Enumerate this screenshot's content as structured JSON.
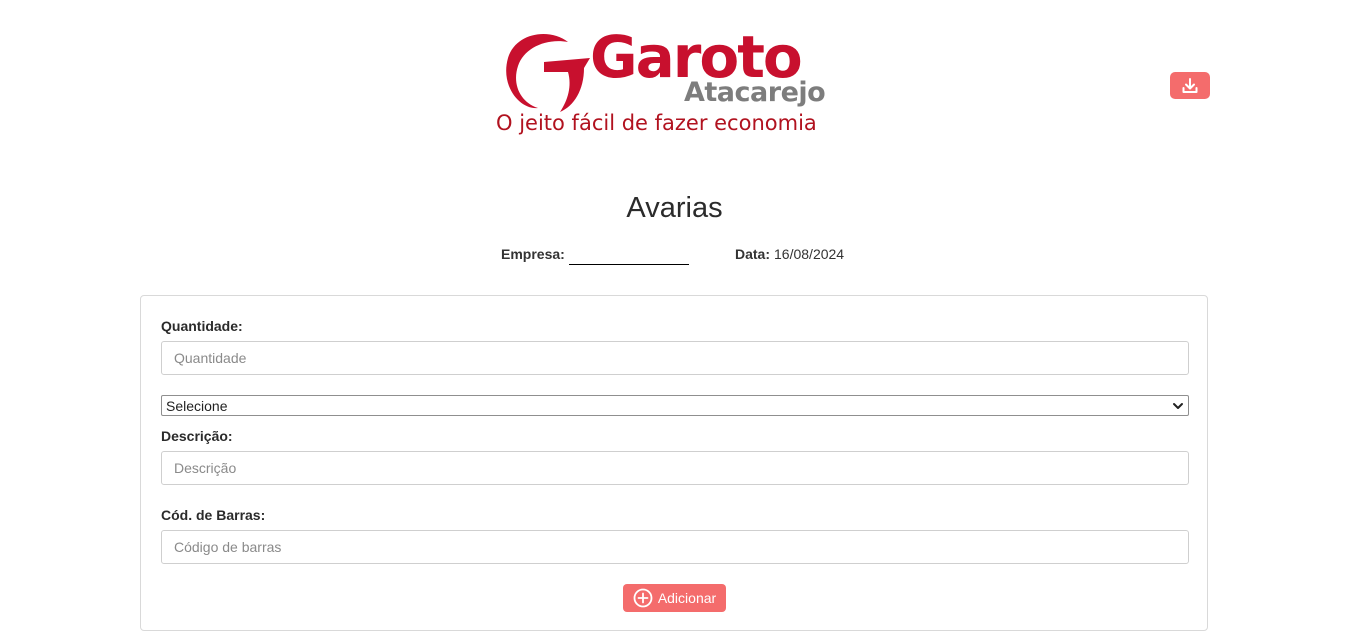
{
  "logo": {
    "brand": "Garoto",
    "subtitle": "Atacarejo",
    "slogan": "O jeito fácil de fazer economia"
  },
  "header": {
    "download_icon": "download-icon",
    "title": "Avarias"
  },
  "meta": {
    "company_label": "Empresa:",
    "company_value": "",
    "date_label": "Data:",
    "date_value": "16/08/2024"
  },
  "form": {
    "quantity_label": "Quantidade:",
    "quantity_placeholder": "Quantidade",
    "select_value": "Selecione",
    "description_label": "Descrição:",
    "description_placeholder": "Descrição",
    "barcode_label": "Cód. de Barras:",
    "barcode_placeholder": "Código de barras",
    "add_label": "Adicionar",
    "add_icon": "plus-circle-icon"
  },
  "colors": {
    "brand_red": "#c8102e",
    "button_red": "#f46c6c",
    "brand_gray": "#7d7d7d"
  }
}
